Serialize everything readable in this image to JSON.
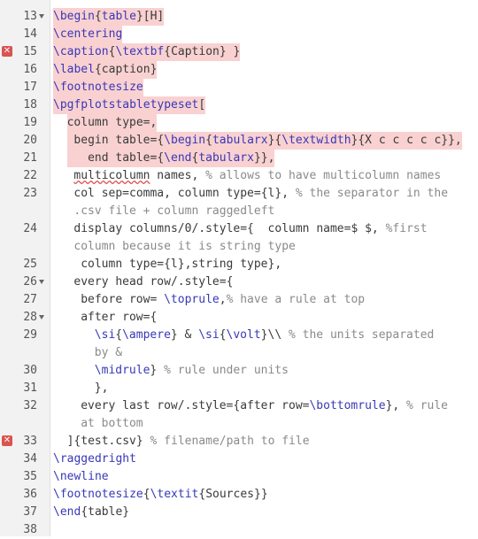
{
  "editor": {
    "lines": [
      {
        "n": "13",
        "fold": true,
        "err": false,
        "indent": 0,
        "hl": true,
        "segs": [
          [
            "cmd",
            "\\begin"
          ],
          [
            "arg",
            "{"
          ],
          [
            "cmd",
            "table"
          ],
          [
            "arg",
            "}[H]"
          ]
        ]
      },
      {
        "n": "14",
        "fold": false,
        "err": false,
        "indent": 0,
        "hl": true,
        "segs": [
          [
            "cmd",
            "\\centering"
          ]
        ]
      },
      {
        "n": "15",
        "fold": false,
        "err": true,
        "indent": 0,
        "hl": true,
        "segs": [
          [
            "cmd",
            "\\caption"
          ],
          [
            "arg",
            "{"
          ],
          [
            "cmd",
            "\\textbf"
          ],
          [
            "arg",
            "{Caption} }"
          ]
        ]
      },
      {
        "n": "16",
        "fold": false,
        "err": false,
        "indent": 0,
        "hl": true,
        "segs": [
          [
            "cmd",
            "\\label"
          ],
          [
            "arg",
            "{caption}"
          ]
        ]
      },
      {
        "n": "17",
        "fold": false,
        "err": false,
        "indent": 0,
        "hl": true,
        "segs": [
          [
            "cmd",
            "\\footnotesize"
          ]
        ]
      },
      {
        "n": "18",
        "fold": false,
        "err": false,
        "indent": 0,
        "hl": true,
        "segs": [
          [
            "cmd",
            "\\pgfplotstabletypeset"
          ],
          [
            "arg",
            "["
          ]
        ]
      },
      {
        "n": "19",
        "fold": false,
        "err": false,
        "indent": 2,
        "hl": true,
        "segs": [
          [
            "arg",
            "column type=,"
          ]
        ]
      },
      {
        "n": "20",
        "fold": false,
        "err": false,
        "indent": 2,
        "hl": true,
        "segs": [
          [
            "arg",
            " begin table={"
          ],
          [
            "cmd",
            "\\begin"
          ],
          [
            "arg",
            "{"
          ],
          [
            "cmd",
            "tabularx"
          ],
          [
            "arg",
            "}{"
          ],
          [
            "cmd",
            "\\textwidth"
          ],
          [
            "arg",
            "}{X c c c c c}},"
          ]
        ]
      },
      {
        "n": "21",
        "fold": false,
        "err": false,
        "indent": 2,
        "hl": true,
        "segs": [
          [
            "arg",
            "   end table={"
          ],
          [
            "cmd",
            "\\end"
          ],
          [
            "arg",
            "{"
          ],
          [
            "cmd",
            "tabularx"
          ],
          [
            "arg",
            "}},"
          ]
        ]
      },
      {
        "n": "22",
        "fold": false,
        "err": false,
        "indent": 3,
        "hl": false,
        "segs": [
          [
            "sq",
            "multicolumn"
          ],
          [
            "arg",
            " names, "
          ],
          [
            "cmt",
            "% allows to have multicolumn names"
          ]
        ]
      },
      {
        "n": "23",
        "fold": false,
        "err": false,
        "indent": 3,
        "hl": false,
        "segs": [
          [
            "arg",
            "col sep=comma, column type={l}, "
          ],
          [
            "cmt",
            "% the separator in the"
          ]
        ]
      },
      {
        "n": "",
        "fold": false,
        "err": false,
        "indent": 3,
        "hl": false,
        "segs": [
          [
            "cmt",
            ".csv file + column raggedleft"
          ]
        ]
      },
      {
        "n": "24",
        "fold": false,
        "err": false,
        "indent": 3,
        "hl": false,
        "segs": [
          [
            "arg",
            "display columns/0/.style={  column name=$ $, "
          ],
          [
            "cmt",
            "%first"
          ]
        ]
      },
      {
        "n": "",
        "fold": false,
        "err": false,
        "indent": 3,
        "hl": false,
        "segs": [
          [
            "cmt",
            "column because it is string type"
          ]
        ]
      },
      {
        "n": "25",
        "fold": false,
        "err": false,
        "indent": 4,
        "hl": false,
        "segs": [
          [
            "arg",
            "column type={l},string type},"
          ]
        ]
      },
      {
        "n": "26",
        "fold": true,
        "err": false,
        "indent": 3,
        "hl": false,
        "segs": [
          [
            "arg",
            "every head row/.style={"
          ]
        ]
      },
      {
        "n": "27",
        "fold": false,
        "err": false,
        "indent": 4,
        "hl": false,
        "segs": [
          [
            "arg",
            "before row= "
          ],
          [
            "cmd",
            "\\toprule"
          ],
          [
            "arg",
            ","
          ],
          [
            "cmt",
            "% have a rule at top"
          ]
        ]
      },
      {
        "n": "28",
        "fold": true,
        "err": false,
        "indent": 4,
        "hl": false,
        "segs": [
          [
            "arg",
            "after row={"
          ]
        ]
      },
      {
        "n": "29",
        "fold": false,
        "err": false,
        "indent": 6,
        "hl": false,
        "segs": [
          [
            "cmd",
            "\\si"
          ],
          [
            "arg",
            "{"
          ],
          [
            "cmd",
            "\\ampere"
          ],
          [
            "arg",
            "} & "
          ],
          [
            "cmd",
            "\\si"
          ],
          [
            "arg",
            "{"
          ],
          [
            "cmd",
            "\\volt"
          ],
          [
            "arg",
            "}\\\\ "
          ],
          [
            "cmt",
            "% the units separated"
          ]
        ]
      },
      {
        "n": "",
        "fold": false,
        "err": false,
        "indent": 6,
        "hl": false,
        "segs": [
          [
            "cmt",
            "by &"
          ]
        ]
      },
      {
        "n": "30",
        "fold": false,
        "err": false,
        "indent": 6,
        "hl": false,
        "segs": [
          [
            "cmd",
            "\\midrule"
          ],
          [
            "arg",
            "} "
          ],
          [
            "cmt",
            "% rule under units"
          ]
        ]
      },
      {
        "n": "31",
        "fold": false,
        "err": false,
        "indent": 6,
        "hl": false,
        "segs": [
          [
            "arg",
            "},"
          ]
        ]
      },
      {
        "n": "32",
        "fold": false,
        "err": false,
        "indent": 4,
        "hl": false,
        "segs": [
          [
            "arg",
            "every last row/.style={after row="
          ],
          [
            "cmd",
            "\\bottomrule"
          ],
          [
            "arg",
            "}, "
          ],
          [
            "cmt",
            "% rule"
          ]
        ]
      },
      {
        "n": "",
        "fold": false,
        "err": false,
        "indent": 4,
        "hl": false,
        "segs": [
          [
            "cmt",
            "at bottom"
          ]
        ]
      },
      {
        "n": "33",
        "fold": false,
        "err": true,
        "indent": 2,
        "hl": false,
        "segs": [
          [
            "arg",
            "]{test.csv} "
          ],
          [
            "cmt",
            "% filename/path to file"
          ]
        ]
      },
      {
        "n": "34",
        "fold": false,
        "err": false,
        "indent": 0,
        "hl": false,
        "segs": [
          [
            "cmd",
            "\\raggedright"
          ]
        ]
      },
      {
        "n": "35",
        "fold": false,
        "err": false,
        "indent": 0,
        "hl": false,
        "segs": [
          [
            "cmd",
            "\\newline"
          ]
        ]
      },
      {
        "n": "36",
        "fold": false,
        "err": false,
        "indent": 0,
        "hl": false,
        "segs": [
          [
            "cmd",
            "\\footnotesize"
          ],
          [
            "arg",
            "{"
          ],
          [
            "cmd",
            "\\textit"
          ],
          [
            "arg",
            "{Sources}}"
          ]
        ]
      },
      {
        "n": "37",
        "fold": false,
        "err": false,
        "indent": 0,
        "hl": false,
        "segs": [
          [
            "cmd",
            "\\end"
          ],
          [
            "arg",
            "{table}"
          ]
        ]
      },
      {
        "n": "38",
        "fold": false,
        "err": false,
        "indent": 0,
        "hl": false,
        "segs": []
      }
    ],
    "error_glyph": "✕"
  }
}
